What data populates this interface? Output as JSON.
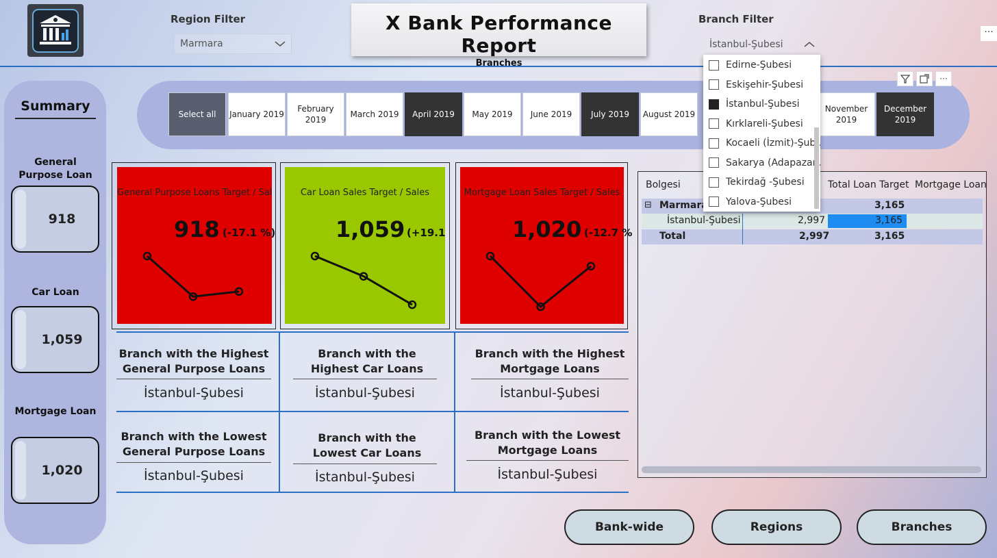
{
  "header": {
    "title": "X Bank Performance Report",
    "subtitle": "Branches",
    "region_filter_label": "Region Filter",
    "region_filter_value": "Marmara",
    "branch_filter_label": "Branch Filter",
    "branch_filter_value": "İstanbul-Şubesi",
    "more_label": "···"
  },
  "summary": {
    "title": "Summary",
    "items": [
      {
        "label": "General Purpose Loan",
        "value": "918"
      },
      {
        "label": "Car Loan",
        "value": "1,059"
      },
      {
        "label": "Mortgage Loan",
        "value": "1,020"
      }
    ]
  },
  "months": [
    {
      "label": "Select all",
      "selected": false
    },
    {
      "label": "January 2019",
      "selected": false
    },
    {
      "label": "February 2019",
      "selected": false
    },
    {
      "label": "March 2019",
      "selected": false
    },
    {
      "label": "April 2019",
      "selected": true
    },
    {
      "label": "May 2019",
      "selected": false
    },
    {
      "label": "June 2019",
      "selected": false
    },
    {
      "label": "July 2019",
      "selected": true
    },
    {
      "label": "August 2019",
      "selected": false
    },
    {
      "label": "November 2019",
      "selected": false
    },
    {
      "label": "December 2019",
      "selected": true
    }
  ],
  "kpis": [
    {
      "title": "General Purpose Loans Target / Sales",
      "value": "918",
      "pct": "(-17.1 %)",
      "color": "#df0000",
      "trend": [
        3,
        1,
        1.25
      ]
    },
    {
      "title": "Car Loan Sales Target / Sales",
      "value": "1,059",
      "pct": "(+19.1",
      "color": "#99c800",
      "trend": [
        3,
        2,
        0.6
      ]
    },
    {
      "title": "Mortgage Loan Sales Target / Sales",
      "value": "1,020",
      "pct": "(-12.7 %",
      "color": "#df0000",
      "trend": [
        3,
        0.5,
        2.5
      ]
    }
  ],
  "branches": {
    "highest": [
      {
        "q": "Branch with the Highest General Purpose Loans",
        "a": "İstanbul-Şubesi"
      },
      {
        "q": "Branch with the Highest Car Loans",
        "a": "İstanbul-Şubesi"
      },
      {
        "q": "Branch with the Highest Mortgage Loans",
        "a": "İstanbul-Şubesi"
      }
    ],
    "lowest": [
      {
        "q": "Branch with the Lowest General Purpose Loans",
        "a": "İstanbul-Şubesi"
      },
      {
        "q": "Branch with the Lowest Car Loans",
        "a": "İstanbul-Şubesi"
      },
      {
        "q": "Branch with the Lowest Mortgage Loans",
        "a": "İstanbul-Şubesi"
      }
    ]
  },
  "matrix": {
    "headers": [
      "Bolgesi",
      "",
      "Total Loan Target",
      "Mortgage Loan"
    ],
    "group": {
      "label": "Marmara",
      "expand": "⊟",
      "total_target": "3,165"
    },
    "row": {
      "label": "İstanbul-Şubesi",
      "sales": "2,997",
      "target": "3,165"
    },
    "total": {
      "label": "Total",
      "sales": "2,997",
      "target": "3,165"
    },
    "highlight_color": "#1e8cf0"
  },
  "branch_list": [
    {
      "label": "Edirne-Şubesi",
      "checked": false
    },
    {
      "label": "Eskişehir-Şubesi",
      "checked": false
    },
    {
      "label": "İstanbul-Şubesi",
      "checked": true
    },
    {
      "label": "Kırklareli-Şubesi",
      "checked": false
    },
    {
      "label": "Kocaeli (İzmit)-Şub...",
      "checked": false
    },
    {
      "label": "Sakarya (Adapazar...",
      "checked": false
    },
    {
      "label": "Tekirdağ -Şubesi",
      "checked": false
    },
    {
      "label": "Yalova-Şubesi",
      "checked": false
    }
  ],
  "nav": [
    "Bank-wide",
    "Regions",
    "Branches"
  ],
  "colors": {
    "accent": "#2a6fc6",
    "red": "#df0000",
    "green": "#99c800"
  }
}
